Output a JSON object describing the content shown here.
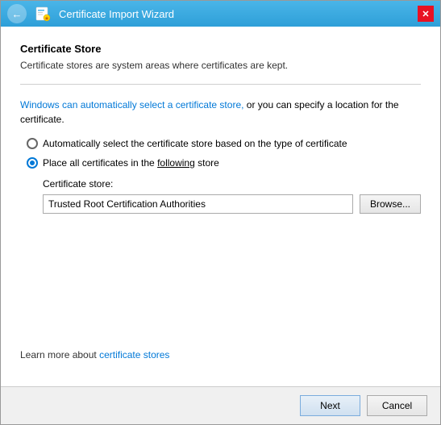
{
  "window": {
    "title": "Certificate Import Wizard",
    "close_label": "✕"
  },
  "section": {
    "title": "Certificate Store",
    "description": "Certificate stores are system areas where certificates are kept."
  },
  "info_text_blue": "Windows can automatically select a certificate store,",
  "info_text_black": " or you can specify a location for the certificate.",
  "radio_options": [
    {
      "id": "auto",
      "label_plain": "Automatically select the certificate store based on the type of certificate",
      "checked": false
    },
    {
      "id": "manual",
      "label_part1": "Place all certificates in the ",
      "label_underline": "following",
      "label_part2": " store",
      "checked": true
    }
  ],
  "store": {
    "label": "Certificate store:",
    "value": "Trusted Root Certification Authorities",
    "browse_label": "Browse..."
  },
  "learn_more": {
    "prefix": "Learn more about ",
    "link_text": "certificate stores"
  },
  "footer": {
    "next_label": "Next",
    "cancel_label": "Cancel"
  }
}
